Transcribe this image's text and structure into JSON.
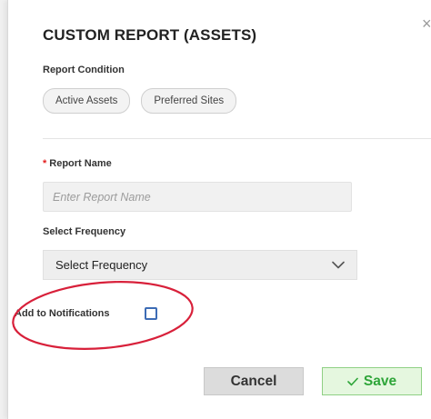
{
  "dialog": {
    "title": "CUSTOM REPORT (ASSETS)",
    "close_glyph": "×"
  },
  "report_condition": {
    "label": "Report Condition",
    "chips": [
      "Active Assets",
      "Preferred Sites"
    ]
  },
  "report_name": {
    "required_mark": "*",
    "label": "Report Name",
    "value": "",
    "placeholder": "Enter Report Name"
  },
  "frequency": {
    "label": "Select Frequency",
    "selected": "Select Frequency"
  },
  "notifications": {
    "label": "Add to Notifications",
    "checked": false
  },
  "buttons": {
    "cancel_label": "Cancel",
    "save_label": "Save"
  },
  "colors": {
    "required": "#e21d1d",
    "checkbox_border": "#3d6cb5",
    "save_text": "#2ea539",
    "save_bg": "#e5f7df",
    "annotation_circle": "#d8203a"
  },
  "icons": {
    "close": "close-icon",
    "dropdown": "chevron-down-icon",
    "save": "check-icon"
  }
}
